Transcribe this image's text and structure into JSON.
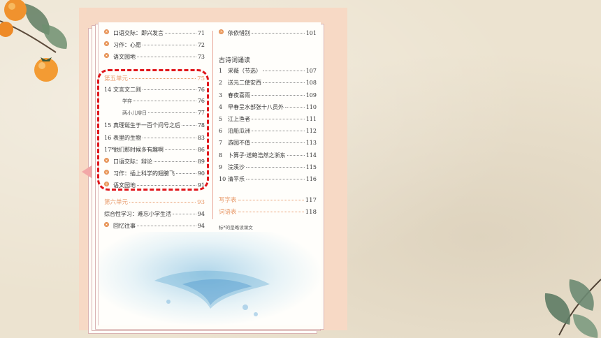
{
  "toc": {
    "left_column": [
      {
        "kind": "bullet",
        "title": "口语交际：即兴发言",
        "page": "71"
      },
      {
        "kind": "bullet",
        "title": "习作：心愿",
        "page": "72"
      },
      {
        "kind": "bullet",
        "title": "语文园地",
        "page": "73"
      },
      {
        "kind": "unit",
        "title": "第五单元",
        "page": "75"
      },
      {
        "kind": "lesson",
        "num": "14",
        "title": "文言文二则",
        "page": "76"
      },
      {
        "kind": "sub",
        "title": "学弈",
        "page": "76"
      },
      {
        "kind": "sub",
        "title": "两小儿辩日",
        "page": "77"
      },
      {
        "kind": "lesson",
        "num": "15",
        "title": "真理诞生于一百个问号之后",
        "page": "78"
      },
      {
        "kind": "lesson",
        "num": "16",
        "title": "表里的生物",
        "page": "83"
      },
      {
        "kind": "lesson",
        "num": "17*",
        "title": "他们那时候多有趣啊",
        "page": "86"
      },
      {
        "kind": "bullet",
        "title": "口语交际：辩论",
        "page": "89"
      },
      {
        "kind": "bullet",
        "title": "习作：插上科学的翅膀飞",
        "page": "90"
      },
      {
        "kind": "bullet",
        "title": "语文园地",
        "page": "91"
      },
      {
        "kind": "unit",
        "title": "第六单元",
        "page": "93"
      },
      {
        "kind": "plain",
        "title": "综合性学习：难忘小学生活",
        "page": "94"
      },
      {
        "kind": "bullet",
        "title": "回忆往事",
        "page": "94"
      }
    ],
    "right_top": {
      "kind": "bullet",
      "title": "依依惜别",
      "page": "101"
    },
    "poetry_heading": "古诗词诵读",
    "poems": [
      {
        "num": "1",
        "title": "采薇（节选）",
        "page": "107"
      },
      {
        "num": "2",
        "title": "送元二使安西",
        "page": "108"
      },
      {
        "num": "3",
        "title": "春夜喜雨",
        "page": "109"
      },
      {
        "num": "4",
        "title": "早春呈水部张十八员外",
        "page": "110"
      },
      {
        "num": "5",
        "title": "江上渔者",
        "page": "111"
      },
      {
        "num": "6",
        "title": "泊船瓜洲",
        "page": "112"
      },
      {
        "num": "7",
        "title": "游园不值",
        "page": "113"
      },
      {
        "num": "8",
        "title": "卜算子·送鲍浩然之浙东",
        "page": "114"
      },
      {
        "num": "9",
        "title": "浣溪沙",
        "page": "115"
      },
      {
        "num": "10",
        "title": "清平乐",
        "page": "116"
      }
    ],
    "appendix": [
      {
        "title": "写字表",
        "page": "117"
      },
      {
        "title": "词语表",
        "page": "118"
      }
    ],
    "footnote": "标*的是略读课文"
  },
  "colors": {
    "highlight_border": "#e0161b",
    "unit_title": "#e89a6a",
    "panel": "#f7d9c5"
  }
}
